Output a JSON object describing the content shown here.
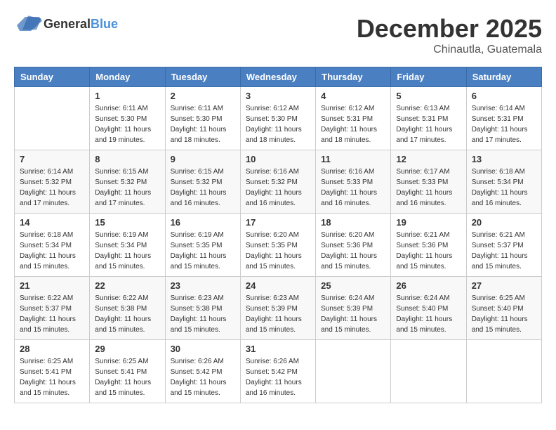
{
  "logo": {
    "general": "General",
    "blue": "Blue"
  },
  "title": {
    "month_year": "December 2025",
    "location": "Chinautla, Guatemala"
  },
  "calendar": {
    "headers": [
      "Sunday",
      "Monday",
      "Tuesday",
      "Wednesday",
      "Thursday",
      "Friday",
      "Saturday"
    ],
    "weeks": [
      [
        {
          "day": "",
          "sunrise": "",
          "sunset": "",
          "daylight": ""
        },
        {
          "day": "1",
          "sunrise": "Sunrise: 6:11 AM",
          "sunset": "Sunset: 5:30 PM",
          "daylight": "Daylight: 11 hours and 19 minutes."
        },
        {
          "day": "2",
          "sunrise": "Sunrise: 6:11 AM",
          "sunset": "Sunset: 5:30 PM",
          "daylight": "Daylight: 11 hours and 18 minutes."
        },
        {
          "day": "3",
          "sunrise": "Sunrise: 6:12 AM",
          "sunset": "Sunset: 5:30 PM",
          "daylight": "Daylight: 11 hours and 18 minutes."
        },
        {
          "day": "4",
          "sunrise": "Sunrise: 6:12 AM",
          "sunset": "Sunset: 5:31 PM",
          "daylight": "Daylight: 11 hours and 18 minutes."
        },
        {
          "day": "5",
          "sunrise": "Sunrise: 6:13 AM",
          "sunset": "Sunset: 5:31 PM",
          "daylight": "Daylight: 11 hours and 17 minutes."
        },
        {
          "day": "6",
          "sunrise": "Sunrise: 6:14 AM",
          "sunset": "Sunset: 5:31 PM",
          "daylight": "Daylight: 11 hours and 17 minutes."
        }
      ],
      [
        {
          "day": "7",
          "sunrise": "Sunrise: 6:14 AM",
          "sunset": "Sunset: 5:32 PM",
          "daylight": "Daylight: 11 hours and 17 minutes."
        },
        {
          "day": "8",
          "sunrise": "Sunrise: 6:15 AM",
          "sunset": "Sunset: 5:32 PM",
          "daylight": "Daylight: 11 hours and 17 minutes."
        },
        {
          "day": "9",
          "sunrise": "Sunrise: 6:15 AM",
          "sunset": "Sunset: 5:32 PM",
          "daylight": "Daylight: 11 hours and 16 minutes."
        },
        {
          "day": "10",
          "sunrise": "Sunrise: 6:16 AM",
          "sunset": "Sunset: 5:32 PM",
          "daylight": "Daylight: 11 hours and 16 minutes."
        },
        {
          "day": "11",
          "sunrise": "Sunrise: 6:16 AM",
          "sunset": "Sunset: 5:33 PM",
          "daylight": "Daylight: 11 hours and 16 minutes."
        },
        {
          "day": "12",
          "sunrise": "Sunrise: 6:17 AM",
          "sunset": "Sunset: 5:33 PM",
          "daylight": "Daylight: 11 hours and 16 minutes."
        },
        {
          "day": "13",
          "sunrise": "Sunrise: 6:18 AM",
          "sunset": "Sunset: 5:34 PM",
          "daylight": "Daylight: 11 hours and 16 minutes."
        }
      ],
      [
        {
          "day": "14",
          "sunrise": "Sunrise: 6:18 AM",
          "sunset": "Sunset: 5:34 PM",
          "daylight": "Daylight: 11 hours and 15 minutes."
        },
        {
          "day": "15",
          "sunrise": "Sunrise: 6:19 AM",
          "sunset": "Sunset: 5:34 PM",
          "daylight": "Daylight: 11 hours and 15 minutes."
        },
        {
          "day": "16",
          "sunrise": "Sunrise: 6:19 AM",
          "sunset": "Sunset: 5:35 PM",
          "daylight": "Daylight: 11 hours and 15 minutes."
        },
        {
          "day": "17",
          "sunrise": "Sunrise: 6:20 AM",
          "sunset": "Sunset: 5:35 PM",
          "daylight": "Daylight: 11 hours and 15 minutes."
        },
        {
          "day": "18",
          "sunrise": "Sunrise: 6:20 AM",
          "sunset": "Sunset: 5:36 PM",
          "daylight": "Daylight: 11 hours and 15 minutes."
        },
        {
          "day": "19",
          "sunrise": "Sunrise: 6:21 AM",
          "sunset": "Sunset: 5:36 PM",
          "daylight": "Daylight: 11 hours and 15 minutes."
        },
        {
          "day": "20",
          "sunrise": "Sunrise: 6:21 AM",
          "sunset": "Sunset: 5:37 PM",
          "daylight": "Daylight: 11 hours and 15 minutes."
        }
      ],
      [
        {
          "day": "21",
          "sunrise": "Sunrise: 6:22 AM",
          "sunset": "Sunset: 5:37 PM",
          "daylight": "Daylight: 11 hours and 15 minutes."
        },
        {
          "day": "22",
          "sunrise": "Sunrise: 6:22 AM",
          "sunset": "Sunset: 5:38 PM",
          "daylight": "Daylight: 11 hours and 15 minutes."
        },
        {
          "day": "23",
          "sunrise": "Sunrise: 6:23 AM",
          "sunset": "Sunset: 5:38 PM",
          "daylight": "Daylight: 11 hours and 15 minutes."
        },
        {
          "day": "24",
          "sunrise": "Sunrise: 6:23 AM",
          "sunset": "Sunset: 5:39 PM",
          "daylight": "Daylight: 11 hours and 15 minutes."
        },
        {
          "day": "25",
          "sunrise": "Sunrise: 6:24 AM",
          "sunset": "Sunset: 5:39 PM",
          "daylight": "Daylight: 11 hours and 15 minutes."
        },
        {
          "day": "26",
          "sunrise": "Sunrise: 6:24 AM",
          "sunset": "Sunset: 5:40 PM",
          "daylight": "Daylight: 11 hours and 15 minutes."
        },
        {
          "day": "27",
          "sunrise": "Sunrise: 6:25 AM",
          "sunset": "Sunset: 5:40 PM",
          "daylight": "Daylight: 11 hours and 15 minutes."
        }
      ],
      [
        {
          "day": "28",
          "sunrise": "Sunrise: 6:25 AM",
          "sunset": "Sunset: 5:41 PM",
          "daylight": "Daylight: 11 hours and 15 minutes."
        },
        {
          "day": "29",
          "sunrise": "Sunrise: 6:25 AM",
          "sunset": "Sunset: 5:41 PM",
          "daylight": "Daylight: 11 hours and 15 minutes."
        },
        {
          "day": "30",
          "sunrise": "Sunrise: 6:26 AM",
          "sunset": "Sunset: 5:42 PM",
          "daylight": "Daylight: 11 hours and 15 minutes."
        },
        {
          "day": "31",
          "sunrise": "Sunrise: 6:26 AM",
          "sunset": "Sunset: 5:42 PM",
          "daylight": "Daylight: 11 hours and 16 minutes."
        },
        {
          "day": "",
          "sunrise": "",
          "sunset": "",
          "daylight": ""
        },
        {
          "day": "",
          "sunrise": "",
          "sunset": "",
          "daylight": ""
        },
        {
          "day": "",
          "sunrise": "",
          "sunset": "",
          "daylight": ""
        }
      ]
    ]
  }
}
